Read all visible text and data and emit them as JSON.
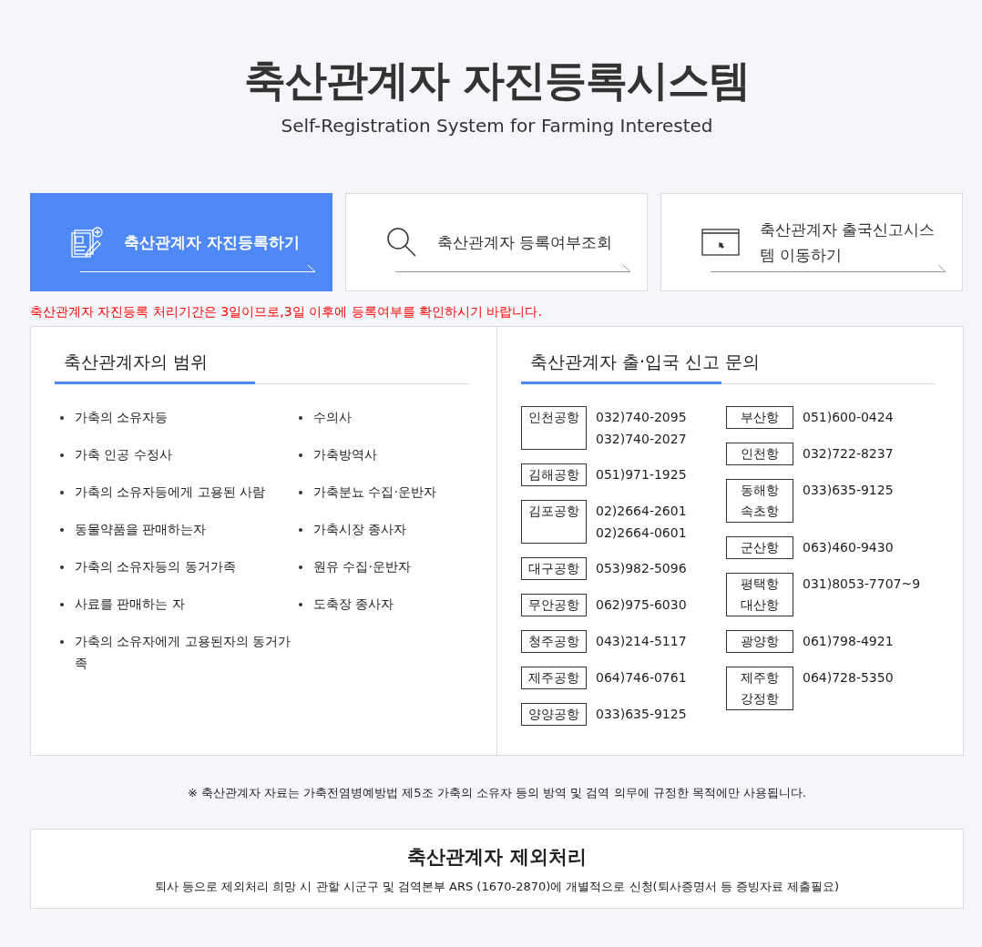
{
  "header": {
    "title": "축산관계자 자진등록시스템",
    "subtitle": "Self-Registration System for Farming Interested"
  },
  "actions": [
    {
      "kind": "register",
      "label": "축산관계자 자진등록하기",
      "selected": true
    },
    {
      "kind": "search",
      "label": "축산관계자 등록여부조회",
      "selected": false
    },
    {
      "kind": "window",
      "label": "축산관계자 출국신고시스템 이동하기",
      "selected": false
    }
  ],
  "notice": "축산관계자 자진등록 처리기간은 3일이므로,3일 이후에 등록여부를 확인하시기 바랍니다.",
  "scope": {
    "heading": "축산관계자의 범위",
    "columns": [
      [
        "가축의 소유자등",
        "가축 인공 수정사",
        "가축의 소유자등에게 고용된 사람",
        "동물약품을 판매하는자",
        "가축의 소유자등의 동거가족",
        "사료를 판매하는 자",
        "가축의 소유자에게 고용된자의 동거가족"
      ],
      [
        "수의사",
        "가축방역사",
        "가축분뇨 수집·운반자",
        "가축시장 종사자",
        "원유 수집·운반자",
        "도축장 종사자"
      ]
    ]
  },
  "contacts": {
    "heading": "축산관계자 출·입국 신고 문의",
    "columns": [
      [
        {
          "names": [
            "인천공항"
          ],
          "phones": [
            "032)740-2095",
            "032)740-2027"
          ]
        },
        {
          "names": [
            "김해공항"
          ],
          "phones": [
            "051)971-1925"
          ]
        },
        {
          "names": [
            "김포공항"
          ],
          "phones": [
            "02)2664-2601",
            "02)2664-0601"
          ]
        },
        {
          "names": [
            "대구공항"
          ],
          "phones": [
            "053)982-5096"
          ]
        },
        {
          "names": [
            "무안공항"
          ],
          "phones": [
            "062)975-6030"
          ]
        },
        {
          "names": [
            "청주공항"
          ],
          "phones": [
            "043)214-5117"
          ]
        },
        {
          "names": [
            "제주공항"
          ],
          "phones": [
            "064)746-0761"
          ]
        },
        {
          "names": [
            "양양공항"
          ],
          "phones": [
            "033)635-9125"
          ]
        }
      ],
      [
        {
          "names": [
            "부산항"
          ],
          "phones": [
            "051)600-0424"
          ]
        },
        {
          "names": [
            "인천항"
          ],
          "phones": [
            "032)722-8237"
          ]
        },
        {
          "names": [
            "동해항",
            "속초항"
          ],
          "phones": [
            "033)635-9125"
          ]
        },
        {
          "names": [
            "군산항"
          ],
          "phones": [
            "063)460-9430"
          ]
        },
        {
          "names": [
            "평택항",
            "대산항"
          ],
          "phones": [
            "031)8053-7707~9"
          ]
        },
        {
          "names": [
            "광양항"
          ],
          "phones": [
            "061)798-4921"
          ]
        },
        {
          "names": [
            "제주항",
            "강정항"
          ],
          "phones": [
            "064)728-5350"
          ]
        }
      ]
    ]
  },
  "footnote": "※ 축산관계자 자료는 가축전염병예방법 제5조 가축의 소유자 등의 방역 및 검역 의무에 규정한 목적에만 사용됩니다.",
  "exclusion": {
    "title": "축산관계자 제외처리",
    "text": "퇴사 등으로 제외처리 희망 시 관할 시군구 및 검역본부 ARS (1670-2870)에 개별적으로 신청(퇴사증명서 등 증빙자료 제출필요)"
  }
}
